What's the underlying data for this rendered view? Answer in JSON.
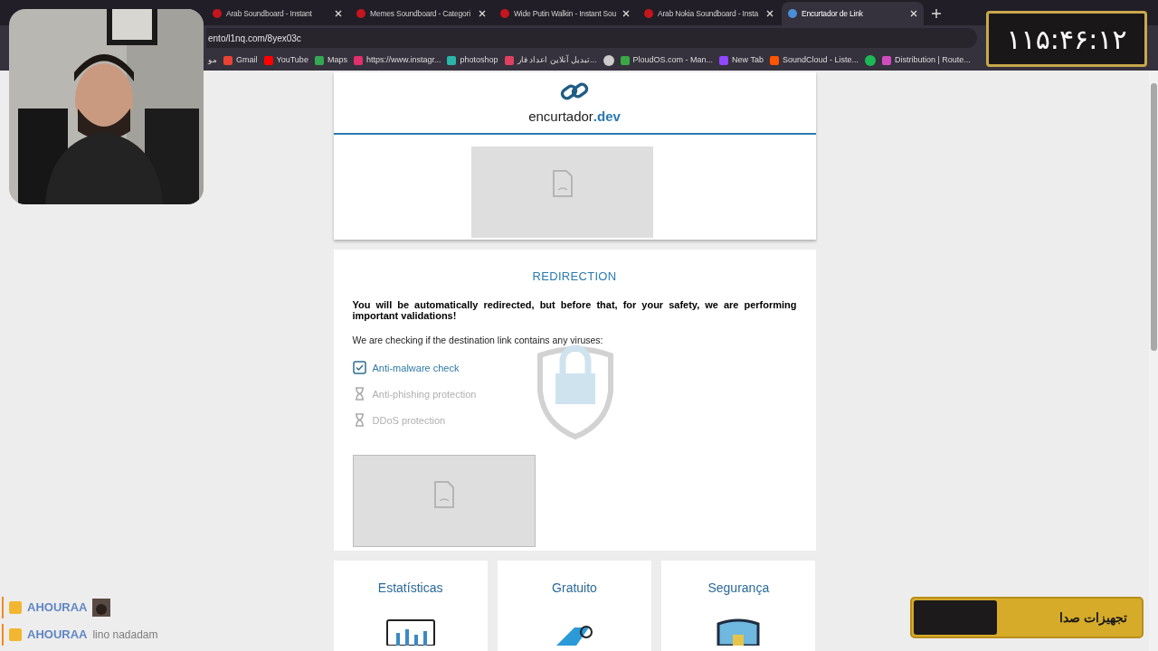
{
  "browser": {
    "tabs": [
      {
        "title": "Arab Soundboard - Instant",
        "selected": false
      },
      {
        "title": "Memes Soundboard - Categori",
        "selected": false
      },
      {
        "title": "Wide Putin Walkin - Instant Sou",
        "selected": false
      },
      {
        "title": "Arab Nokia Soundboard - Insta",
        "selected": false
      },
      {
        "title": "Encurtador de Link",
        "selected": true
      }
    ],
    "url": "ento/l1nq.com/8yex03c",
    "bookmarks": [
      {
        "kind": "text",
        "label": "مو"
      },
      {
        "kind": "link",
        "label": "Gmail"
      },
      {
        "kind": "link",
        "label": "YouTube"
      },
      {
        "kind": "link",
        "label": "Maps"
      },
      {
        "kind": "link",
        "label": "https://www.instagr..."
      },
      {
        "kind": "link",
        "label": "photoshop"
      },
      {
        "kind": "link",
        "label": "تبدیل آنلاین اعداد فار..."
      },
      {
        "kind": "icon"
      },
      {
        "kind": "link",
        "label": "PloudOS.com - Man..."
      },
      {
        "kind": "link",
        "label": "New Tab"
      },
      {
        "kind": "link",
        "label": "SoundCloud - Liste..."
      },
      {
        "kind": "icon"
      },
      {
        "kind": "link",
        "label": "Distribution | Route..."
      }
    ]
  },
  "page": {
    "logo": {
      "name": "encurtador",
      "suffix": ".dev"
    },
    "redirection": {
      "title": "REDIRECTION",
      "warning": "You will be automatically redirected, but before that, for your safety, we are performing important validations!",
      "intro": "We are checking if the destination link contains any viruses:",
      "checks": [
        {
          "label": "Anti-malware check",
          "checked": true
        },
        {
          "label": "Anti-phishing protection",
          "checked": false
        },
        {
          "label": "DDoS protection",
          "checked": false
        }
      ]
    },
    "features": [
      {
        "title": "Estatísticas"
      },
      {
        "title": "Gratuito"
      },
      {
        "title": "Segurança"
      }
    ]
  },
  "overlays": {
    "timer": "۱۱۵:۴۶:۱۲",
    "chat": [
      {
        "kind": "emote",
        "user": "AHOURAA"
      },
      {
        "kind": "text",
        "user": "AHOURAA",
        "message": "lino nadadam"
      }
    ],
    "banner": "تجهیزات صدا"
  }
}
